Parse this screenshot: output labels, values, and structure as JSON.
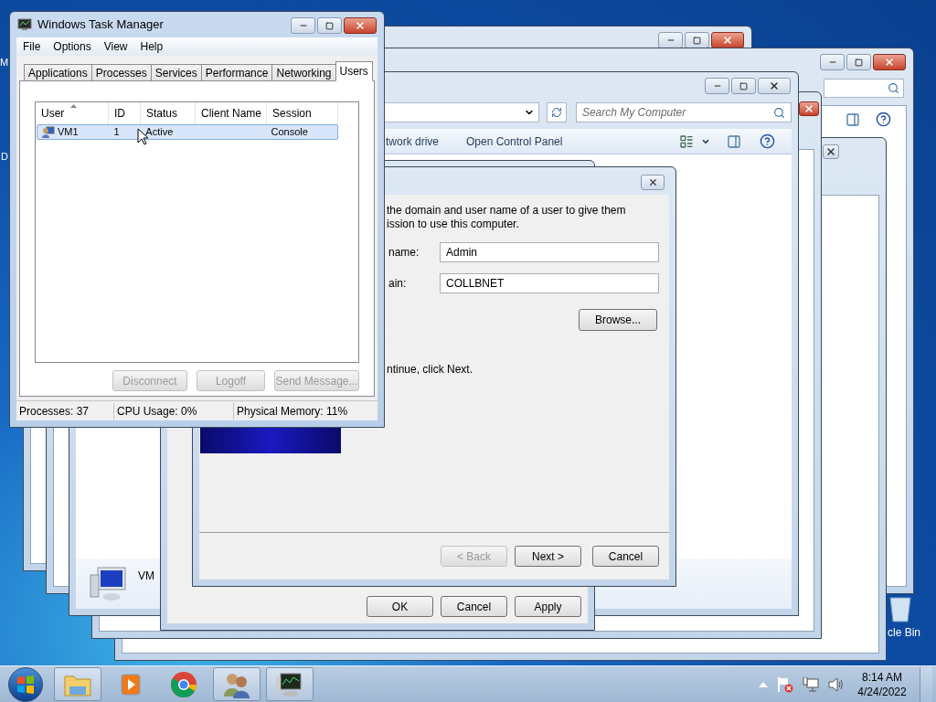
{
  "desktop_icons": [
    {
      "label": "M"
    },
    {
      "label": "D"
    },
    {
      "label": "cle Bin"
    }
  ],
  "background_windows": [
    {
      "close_red": true
    },
    {
      "close_red": true
    },
    {
      "close_red": false
    },
    {
      "close_red": true
    },
    {
      "close_red": false
    }
  ],
  "explorer": {
    "search_placeholder": "Search My Computer",
    "toolbar": [
      "twork drive",
      "Open Control Panel"
    ],
    "details_name": "VM"
  },
  "properties_dialog": {
    "buttons": [
      {
        "label": "OK",
        "disabled": false
      },
      {
        "label": "Cancel",
        "disabled": false
      },
      {
        "label": "Apply",
        "disabled": false
      }
    ]
  },
  "wizard": {
    "instructions": [
      "the domain and user name of a user to give them",
      "ission to use this computer."
    ],
    "fields": [
      {
        "label": "name:",
        "value": "Admin"
      },
      {
        "label": "ain:",
        "value": "COLLBNET"
      }
    ],
    "browse": "Browse...",
    "hint": "ntinue, click Next.",
    "buttons": [
      {
        "label": "< Back",
        "disabled": true
      },
      {
        "label": "Next >",
        "disabled": false
      },
      {
        "label": "Cancel",
        "disabled": false
      }
    ]
  },
  "task_manager": {
    "title": "Windows Task Manager",
    "menu": [
      "File",
      "Options",
      "View",
      "Help"
    ],
    "tabs": [
      {
        "label": "Applications",
        "selected": false
      },
      {
        "label": "Processes",
        "selected": false
      },
      {
        "label": "Services",
        "selected": false
      },
      {
        "label": "Performance",
        "selected": false
      },
      {
        "label": "Networking",
        "selected": false
      },
      {
        "label": "Users",
        "selected": true
      }
    ],
    "columns": [
      "User",
      "ID",
      "Status",
      "Client Name",
      "Session"
    ],
    "rows": [
      {
        "cells": [
          "VM1",
          "1",
          "Active",
          "",
          "Console"
        ],
        "selected": true
      }
    ],
    "buttons": [
      {
        "label": "Disconnect",
        "disabled": true
      },
      {
        "label": "Logoff",
        "disabled": true
      },
      {
        "label": "Send Message...",
        "disabled": true
      }
    ],
    "status_bar": [
      "Processes: 37",
      "CPU Usage: 0%",
      "Physical Memory: 11%"
    ]
  },
  "taskbar": {
    "apps": [
      {
        "kind": "explorer",
        "running": true
      },
      {
        "kind": "media",
        "running": false
      },
      {
        "kind": "chrome",
        "running": false
      },
      {
        "kind": "users",
        "running": true
      },
      {
        "kind": "taskmgr",
        "running": true
      }
    ],
    "time": "8:14 AM",
    "date": "4/24/2022"
  }
}
